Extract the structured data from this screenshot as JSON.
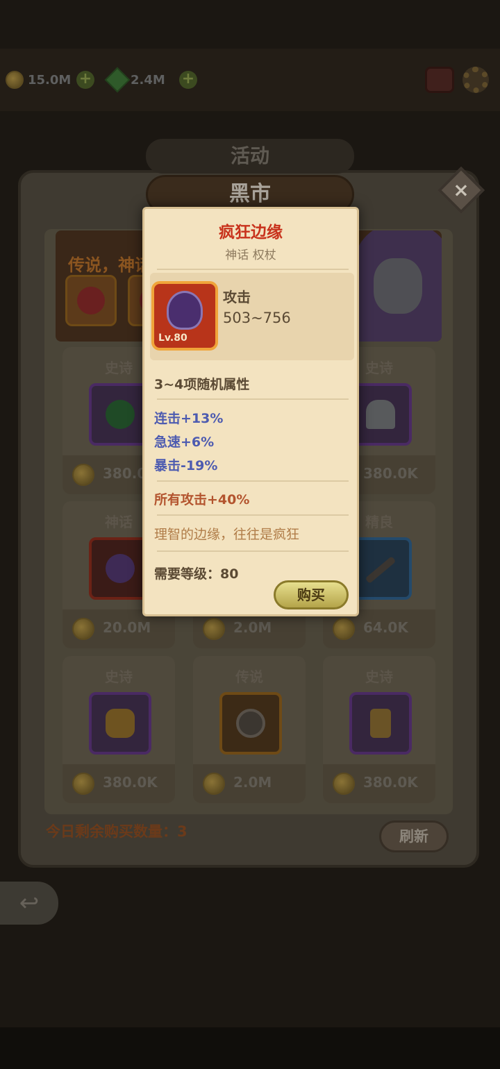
{
  "resources": {
    "gold": "15.0M",
    "gems": "2.4M"
  },
  "header": {
    "tab_back": "活动",
    "title": "黑市",
    "close": "×"
  },
  "banner": {
    "text": "传说，神话"
  },
  "cards": [
    {
      "rarity": "史诗",
      "price": "380.0K",
      "item": "green-bomb"
    },
    {
      "rarity": "史诗",
      "price": "380.0K",
      "item": "iron-helmet"
    },
    {
      "rarity": "神话",
      "price": "20.0M",
      "item": "mythic-staff"
    },
    {
      "rarity": "",
      "price": "2.0M",
      "item": "hidden"
    },
    {
      "rarity": "精良",
      "price": "64.0K",
      "item": "dagger"
    },
    {
      "rarity": "史诗",
      "price": "380.0K",
      "item": "golden-cloak"
    },
    {
      "rarity": "传说",
      "price": "2.0M",
      "item": "round-shield"
    },
    {
      "rarity": "史诗",
      "price": "380.0K",
      "item": "amulet"
    }
  ],
  "footer": {
    "remain": "今日剩余购买数量：3",
    "refresh": "刷新"
  },
  "popup": {
    "title": "疯狂边缘",
    "subtitle": "神话 权杖",
    "level_badge": "Lv.80",
    "stat_label": "攻击",
    "stat_value": "503~756",
    "random_attrs": "3~4项随机属性",
    "attrs": [
      "连击+13%",
      "急速+6%",
      "暴击-19%"
    ],
    "bonus": "所有攻击+40%",
    "flavor": "理智的边缘，往往是疯狂",
    "required_level": "需要等级：80",
    "buy": "购买"
  },
  "colors": {
    "mythic_title": "#c8321c",
    "attr_blue": "#4d5bb0",
    "bonus_red": "#b3542e",
    "buy_gold": "#d6c96a"
  }
}
